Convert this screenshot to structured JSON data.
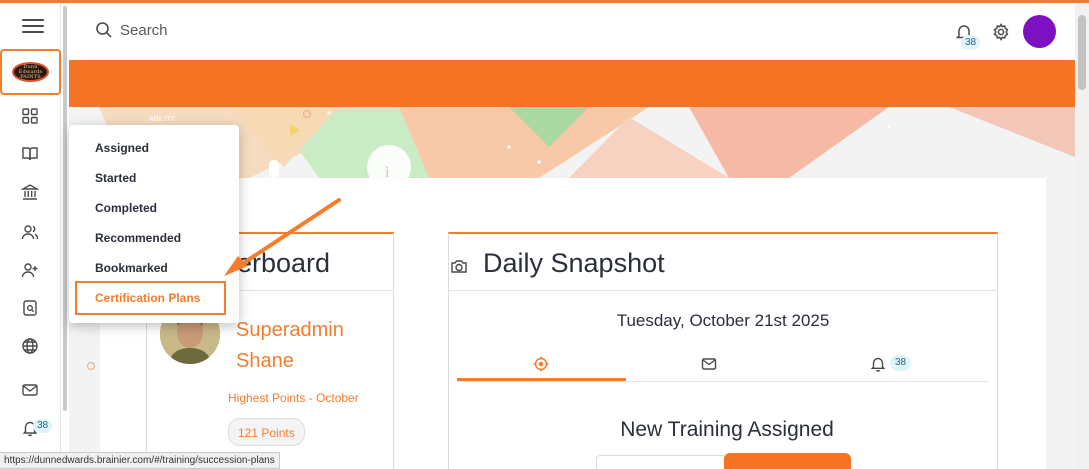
{
  "header": {
    "search_placeholder": "Search",
    "notification_count": "38"
  },
  "sidebar": {
    "logo_text": "Dunn Edwards PAINTS",
    "items": [
      {
        "icon": "dashboard-icon"
      },
      {
        "icon": "book-icon"
      },
      {
        "icon": "institution-icon"
      },
      {
        "icon": "users-icon"
      },
      {
        "icon": "add-user-icon"
      },
      {
        "icon": "search-document-icon"
      },
      {
        "icon": "globe-icon"
      },
      {
        "icon": "mail-icon"
      },
      {
        "icon": "bell-icon"
      }
    ],
    "bell_count": "38"
  },
  "dropdown": {
    "items": [
      "Assigned",
      "Started",
      "Completed",
      "Recommended",
      "Bookmarked",
      "Certification Plans"
    ],
    "highlighted": "Certification Plans"
  },
  "leaderboard": {
    "title_visible": "erboard",
    "name": "Superadmin Shane",
    "subtitle": "Highest Points - October",
    "points": "121 Points"
  },
  "daily_snapshot": {
    "title": "Daily Snapshot",
    "date": "Tuesday, October 21st 2025",
    "tabs": [
      {
        "icon": "target-icon",
        "active": true
      },
      {
        "icon": "mail-icon",
        "active": false
      },
      {
        "icon": "bell-icon",
        "active": false,
        "badge": "38"
      }
    ],
    "section_title": "New Training Assigned"
  },
  "banner": {
    "fragment_text": "ABILITY"
  },
  "status_bar": {
    "url": "https://dunnedwards.brainier.com/#/training/succession-plans"
  },
  "colors": {
    "accent": "#f47c2c",
    "band": "#f47324",
    "avatar": "#7d10c0",
    "badge_bg": "#dff3f8"
  }
}
